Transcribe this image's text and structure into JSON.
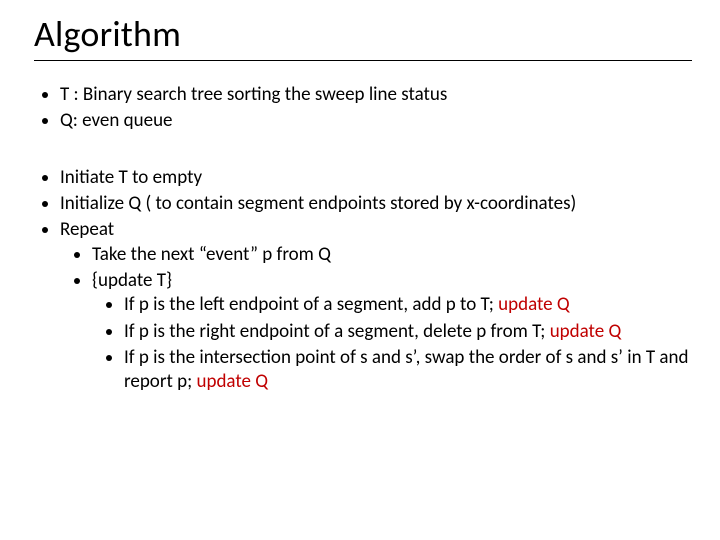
{
  "title": "Algorithm",
  "defs": {
    "t": "T : Binary search tree sorting the sweep line status",
    "q": "Q: even queue"
  },
  "steps": {
    "init_t": "Initiate T to empty",
    "init_q": "Initialize Q ( to contain segment endpoints stored by x-coordinates)",
    "repeat": "Repeat",
    "take_event": "Take the next “event” p from Q",
    "update_t_label": "{update T}",
    "left_ep_a": "If p is the left endpoint of a segment, add p to T; ",
    "left_ep_b": "update  Q",
    "right_ep_a": "If p is the right endpoint of a segment, delete p from T; ",
    "right_ep_b": "update Q",
    "intersect_a": "If p is the intersection point of s and s’, swap the order of s and s’ in T and report p; ",
    "intersect_b": "update Q"
  }
}
